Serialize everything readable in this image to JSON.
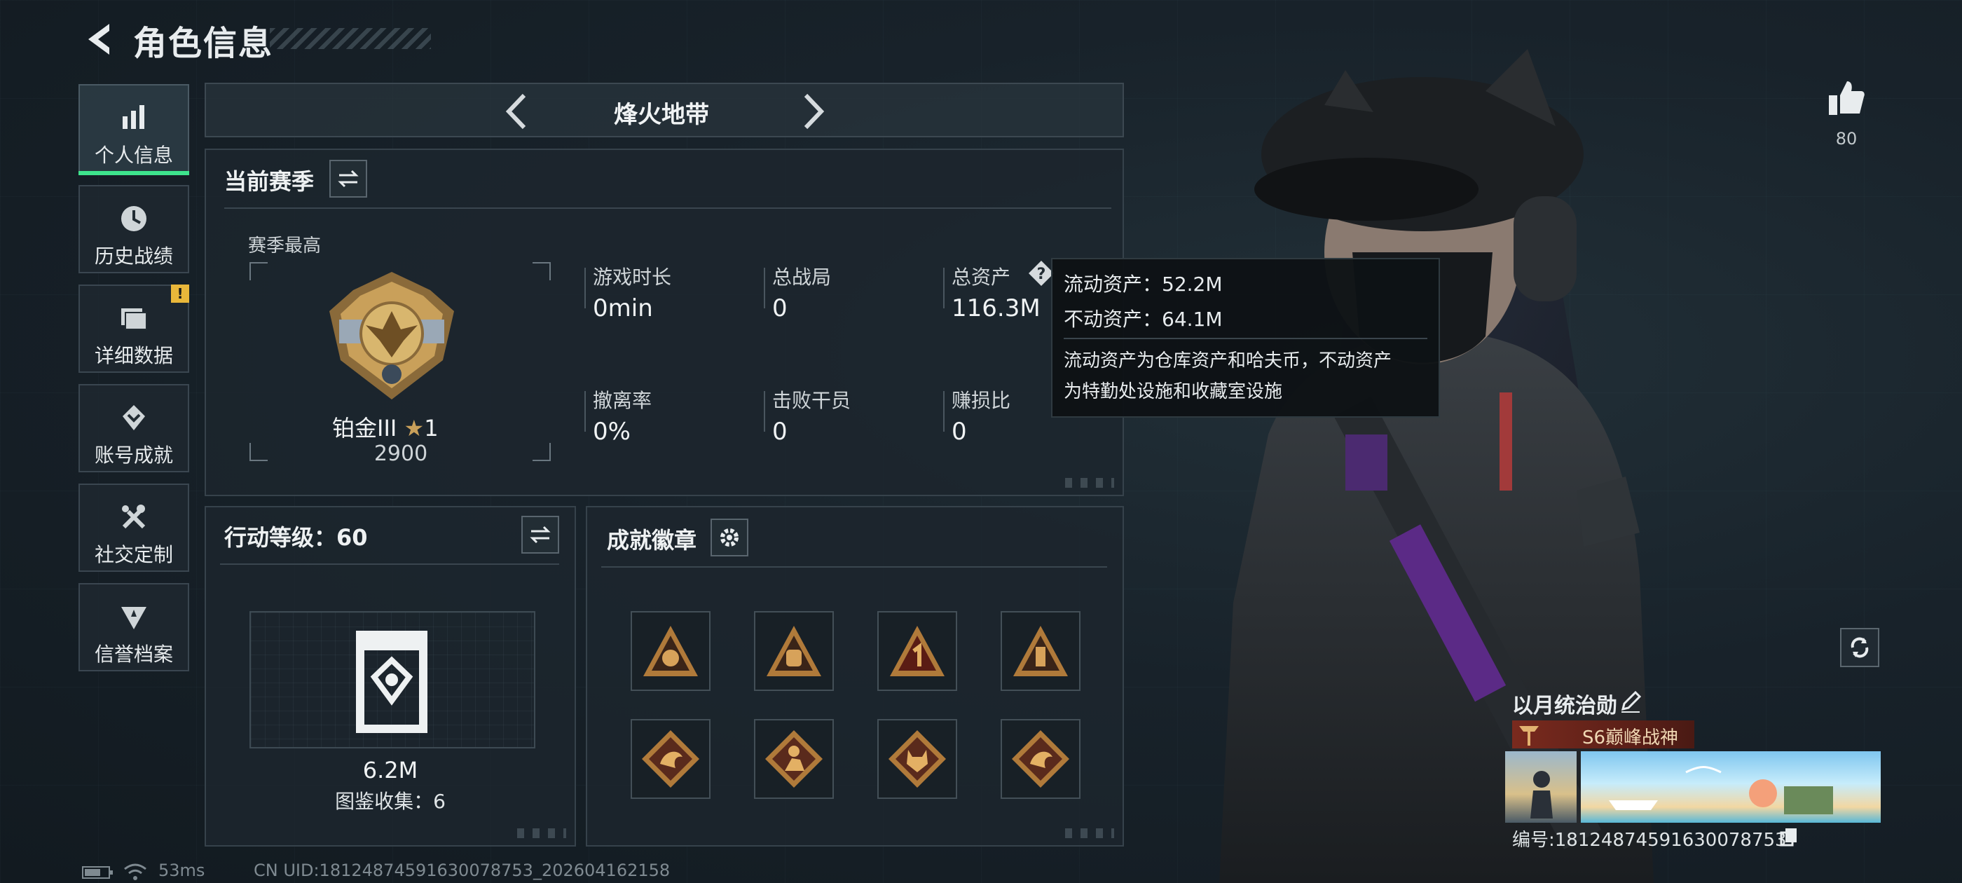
{
  "header": {
    "title": "角色信息"
  },
  "sidebar": {
    "items": [
      {
        "label": "个人信息",
        "icon": "bar-chart-icon",
        "active": true
      },
      {
        "label": "历史战绩",
        "icon": "clock-icon"
      },
      {
        "label": "详细数据",
        "icon": "folder-icon",
        "badge": "!"
      },
      {
        "label": "账号成就",
        "icon": "achievement-icon"
      },
      {
        "label": "社交定制",
        "icon": "tools-icon"
      },
      {
        "label": "信誉档案",
        "icon": "shield-star-icon"
      }
    ]
  },
  "mode_selector": {
    "label": "烽火地带"
  },
  "season": {
    "title": "当前赛季",
    "best_label": "赛季最高",
    "rank_name": "铂金III",
    "rank_stars": "1",
    "rank_points": "2900",
    "stats": [
      {
        "label": "游戏时长",
        "value": "0min"
      },
      {
        "label": "总战局",
        "value": "0"
      },
      {
        "label": "总资产",
        "value": "116.3M"
      },
      {
        "label": "撤离率",
        "value": "0%"
      },
      {
        "label": "击败干员",
        "value": "0"
      },
      {
        "label": "赚损比",
        "value": "0"
      }
    ]
  },
  "tooltip": {
    "liquid": "流动资产：52.2M",
    "fixed": "不动资产：64.1M",
    "desc_line1": "流动资产为仓库资产和哈夫币，不动资产",
    "desc_line2": "为特勤处设施和收藏室设施"
  },
  "action_level": {
    "title": "行动等级：60",
    "value": "6.2M",
    "collection": "图鉴收集：6"
  },
  "achievements": {
    "title": "成就徽章",
    "badges": [
      {
        "icon": "triangle-badge-icon"
      },
      {
        "icon": "backpack-badge-icon"
      },
      {
        "icon": "number-one-badge-icon"
      },
      {
        "icon": "bottle-badge-icon"
      },
      {
        "icon": "dragon-badge-icon"
      },
      {
        "icon": "soldier-badge-icon"
      },
      {
        "icon": "wolf-badge-icon"
      },
      {
        "icon": "dragon-badge-icon"
      }
    ]
  },
  "likes": {
    "count": "80"
  },
  "player": {
    "name": "以月统治勋",
    "title": "S6巅峰战神",
    "id_text": "编号:18124874591630078753"
  },
  "footer": {
    "ping": "53ms",
    "uid": "CN UID:18124874591630078753_202604162158"
  },
  "colors": {
    "accent": "#3ee48d",
    "warning": "#e9b73a",
    "rank_gold": "#c9a05a"
  }
}
